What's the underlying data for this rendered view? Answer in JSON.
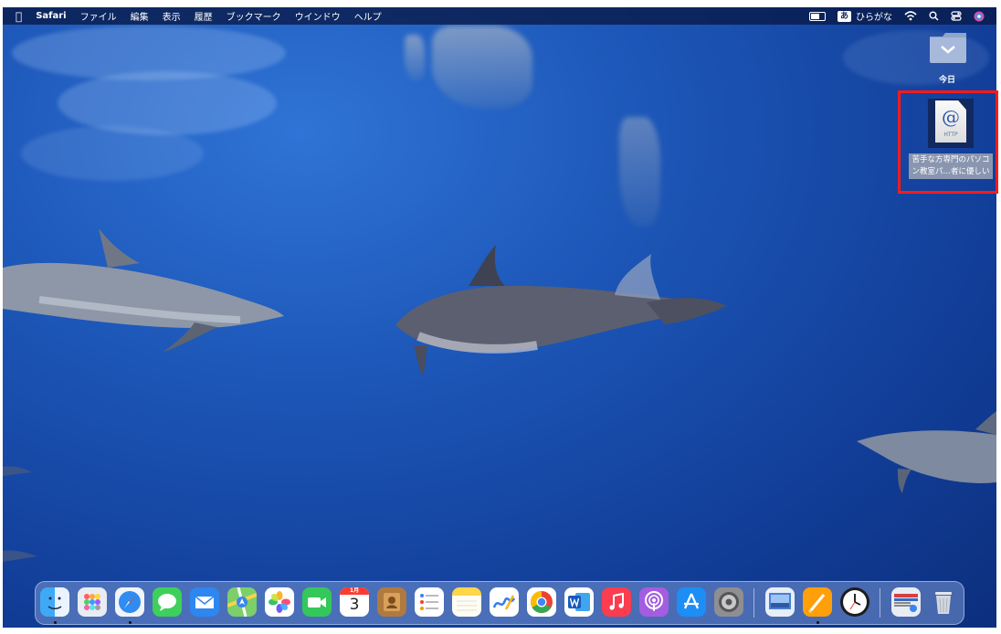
{
  "menubar": {
    "apple": "",
    "app": "Safari",
    "menus": [
      "ファイル",
      "編集",
      "表示",
      "履歴",
      "ブックマーク",
      "ウインドウ",
      "ヘルプ"
    ],
    "ime_badge": "あ",
    "input_source": "ひらがな"
  },
  "desktop": {
    "folder_label": "今日",
    "webloc": {
      "glyph": "@",
      "type": "HTTP",
      "label_line1": "苦手な方専門のパソコ",
      "label_line2": "ン教室パ…者に優しい"
    }
  },
  "dock": {
    "calendar_month": "1月",
    "calendar_day": "3",
    "items": [
      "finder",
      "launchpad",
      "safari",
      "messages",
      "mail",
      "maps",
      "photos",
      "facetime",
      "calendar",
      "contacts",
      "reminders",
      "notes",
      "freeform",
      "chrome",
      "word",
      "music",
      "podcasts",
      "app-store",
      "system-settings",
      "preview",
      "pages",
      "clock",
      "downloads",
      "trash"
    ]
  },
  "colors": {
    "menubar": "#081846",
    "highlight": "#ff1a1a",
    "ocean": "#1d57b8"
  }
}
